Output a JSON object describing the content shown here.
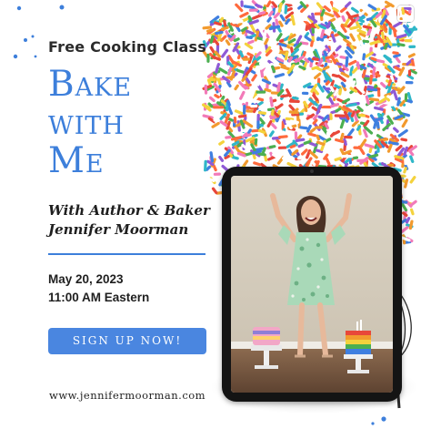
{
  "flyer": {
    "subtitle": "Free Cooking Class",
    "headline": [
      "Bake",
      "with",
      "Me"
    ],
    "byline": [
      "With Author & Baker",
      "Jennifer Moorman"
    ],
    "date": "May 20, 2023",
    "time": "11:00 AM Eastern",
    "cta_label": "SIGN UP NOW!",
    "website": "www.jennifermoorman.com"
  },
  "colors": {
    "accent": "#3d7fdb",
    "button": "#4a86e0",
    "text": "#1f1f1f"
  },
  "icons": {
    "corner": "instagram-multi-photo-icon",
    "whisk": "whisk-icon"
  },
  "tablet_photo": {
    "subject": "woman-in-green-floral-dress",
    "props": [
      "rainbow-layer-cake",
      "rainbow-cake-on-stand"
    ]
  }
}
